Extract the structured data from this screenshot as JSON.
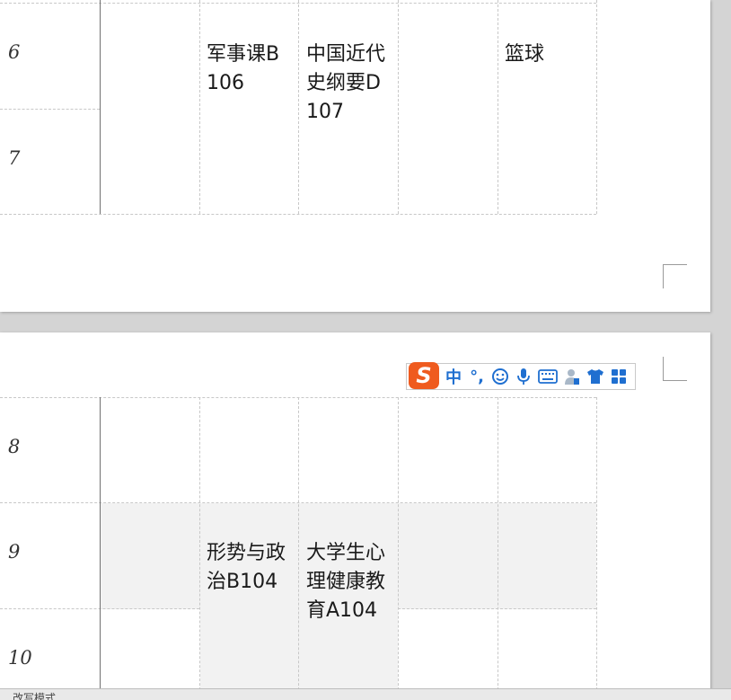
{
  "top_table": {
    "row_numbers": [
      "6",
      "7"
    ],
    "cells": {
      "tue": "军事课B106",
      "wed": "中国近代史纲要D107",
      "sat": "篮球"
    }
  },
  "bottom_table": {
    "row_numbers": [
      "8",
      "9",
      "10"
    ],
    "cells": {
      "tue": "形势与政治B104",
      "wed": "大学生心理健康教育A104"
    }
  },
  "ime_toolbar": {
    "logo": "S",
    "mode": "中",
    "punct": "°,",
    "icons": [
      "smiley-icon",
      "microphone-icon",
      "keyboard-icon",
      "user-icon",
      "shirt-icon",
      "grid-icon"
    ]
  },
  "status_bar": {
    "mode_text": "改写模式"
  }
}
